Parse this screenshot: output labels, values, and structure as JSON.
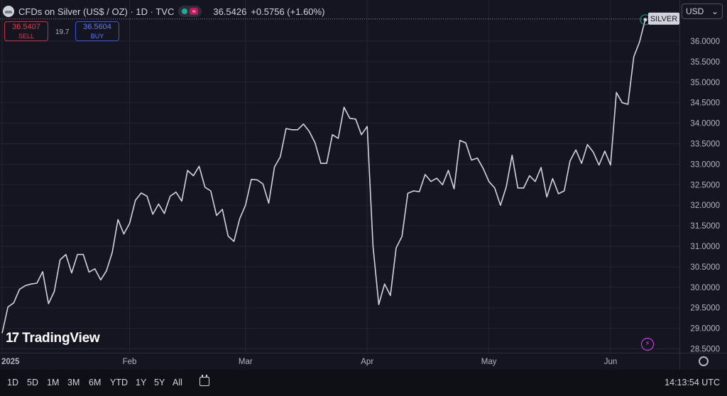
{
  "header": {
    "symbol_title": "CFDs on Silver (US$ / OZ) · 1D · TVC",
    "last_price": "36.5426",
    "change": "+0.5756 (+1.60%)"
  },
  "trade": {
    "sell_price": "36.5407",
    "sell_label": "SELL",
    "spread": "19.7",
    "buy_price": "36.5604",
    "buy_label": "BUY"
  },
  "currency": "USD",
  "logo_text": "TradingView",
  "timeframes": [
    "1D",
    "5D",
    "1M",
    "3M",
    "6M",
    "YTD",
    "1Y",
    "5Y",
    "All"
  ],
  "clock": "14:13:54 UTC",
  "colors": {
    "background": "#151521",
    "line": "#d1d4dc",
    "sell": "#f23645",
    "buy": "#5b7cfa",
    "grid": "#232532"
  },
  "chart_data": {
    "type": "line",
    "symbol_label": "SILVER",
    "ylim": [
      28.5,
      36.4
    ],
    "y_ticks": [
      "28.5000",
      "29.0000",
      "29.5000",
      "30.0000",
      "30.5000",
      "31.0000",
      "31.5000",
      "32.0000",
      "32.5000",
      "33.0000",
      "33.5000",
      "34.0000",
      "34.5000",
      "35.0000",
      "35.5000",
      "36.0000"
    ],
    "x_tick_labels": [
      {
        "label": "2025",
        "index": 0
      },
      {
        "label": "Feb",
        "index": 22
      },
      {
        "label": "Mar",
        "index": 42
      },
      {
        "label": "Apr",
        "index": 63
      },
      {
        "label": "May",
        "index": 84
      },
      {
        "label": "Jun",
        "index": 105
      }
    ],
    "series": [
      {
        "values": [
          28.88,
          29.52,
          29.62,
          29.95,
          30.04,
          30.08,
          30.1,
          30.38,
          29.6,
          29.9,
          30.67,
          30.8,
          30.35,
          30.8,
          30.8,
          30.37,
          30.45,
          30.18,
          30.4,
          30.85,
          31.65,
          31.3,
          31.56,
          32.12,
          32.3,
          32.22,
          31.78,
          32.03,
          31.8,
          32.22,
          32.32,
          32.1,
          32.85,
          32.72,
          32.95,
          32.44,
          32.35,
          31.75,
          31.9,
          31.25,
          31.12,
          31.67,
          32.0,
          32.63,
          32.62,
          32.52,
          32.05,
          32.93,
          33.18,
          33.87,
          33.84,
          33.84,
          33.98,
          33.8,
          33.52,
          33.02,
          33.02,
          33.72,
          33.63,
          34.39,
          34.12,
          34.1,
          33.72,
          33.92,
          31.0,
          29.58,
          30.08,
          29.8,
          30.96,
          31.24,
          32.29,
          32.35,
          32.33,
          32.75,
          32.58,
          32.66,
          32.5,
          32.85,
          32.4,
          33.58,
          33.52,
          33.1,
          33.15,
          32.9,
          32.58,
          32.42,
          32.0,
          32.45,
          33.22,
          32.42,
          32.42,
          32.72,
          32.58,
          32.92,
          32.2,
          32.65,
          32.28,
          32.35,
          33.08,
          33.35,
          33.02,
          33.48,
          33.3,
          32.98,
          33.32,
          32.98,
          34.75,
          34.5,
          34.46,
          35.62,
          35.98,
          36.54
        ]
      }
    ]
  }
}
